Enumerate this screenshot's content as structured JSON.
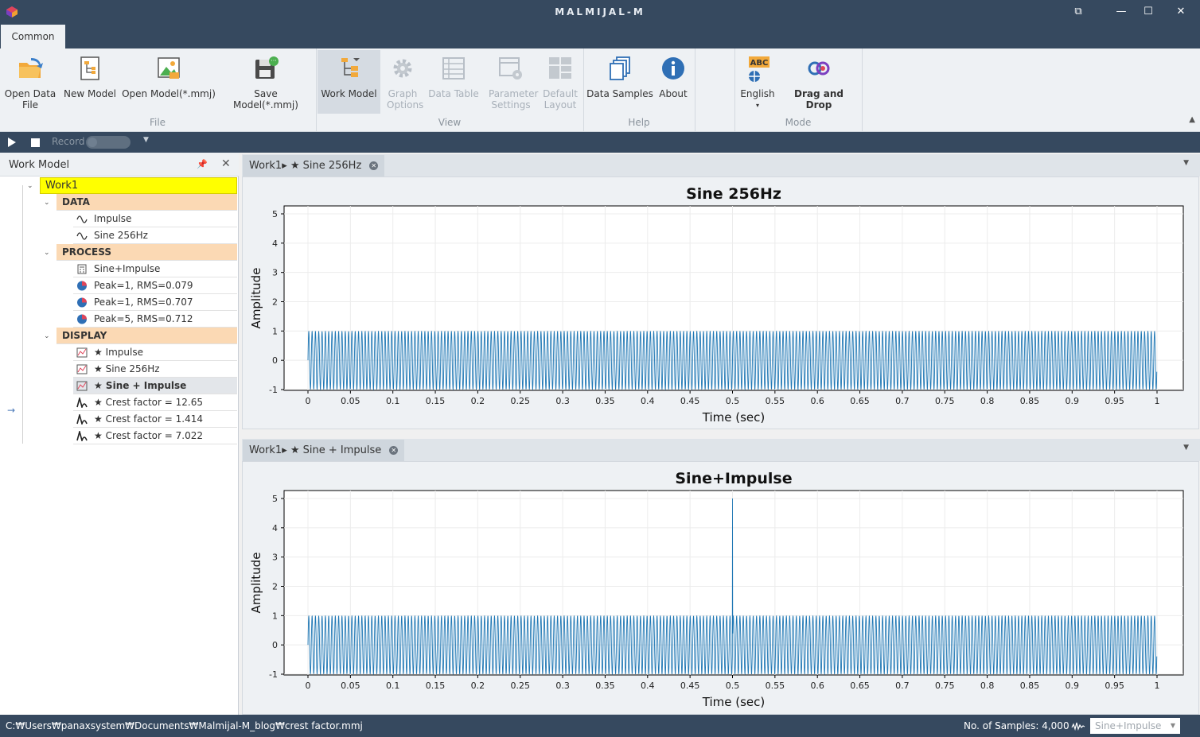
{
  "window": {
    "title": "MALMIJAL-M",
    "controls": {
      "restore": "⧉",
      "minimize": "—",
      "maximize": "☐",
      "close": "✕"
    }
  },
  "ribbon": {
    "tab": "Common",
    "buttons": {
      "open_data_file": "Open Data File",
      "new_model": "New Model",
      "open_model": "Open Model(*.mmj)",
      "save_model": "Save Model(*.mmj)",
      "work_model": "Work Model",
      "graph_options": "Graph Options",
      "data_table": "Data Table",
      "parameter_settings": "Parameter Settings",
      "default_layout": "Default Layout",
      "data_samples": "Data Samples",
      "about": "About",
      "english": "English",
      "drag_and_drop": "Drag and Drop"
    },
    "groups": {
      "file": "File",
      "view": "View",
      "help": "Help",
      "mode": "Mode"
    },
    "language_badge": "ABC"
  },
  "player": {
    "record_label": "Record"
  },
  "work_model_panel": {
    "title": "Work Model",
    "root": "Work1",
    "sections": {
      "data": "DATA",
      "process": "PROCESS",
      "display": "DISPLAY"
    },
    "data_items": [
      "Impulse",
      "Sine 256Hz"
    ],
    "process_items": [
      "Sine+Impulse",
      "Peak=1, RMS=0.079",
      "Peak=1, RMS=0.707",
      "Peak=5, RMS=0.712"
    ],
    "display_items": [
      "★ Impulse",
      "★ Sine 256Hz",
      "★ Sine + Impulse",
      "★ Crest factor = 12.65",
      "★ Crest factor = 1.414",
      "★ Crest factor = 7.022"
    ]
  },
  "doc1": {
    "tab_label": "Work1▸ ★ Sine 256Hz"
  },
  "doc2": {
    "tab_label": "Work1▸ ★ Sine + Impulse"
  },
  "chart_data": [
    {
      "type": "line",
      "title": "Sine 256Hz",
      "xlabel": "Time (sec)",
      "ylabel": "Amplitude",
      "xlim": [
        0,
        1
      ],
      "ylim": [
        -1,
        5
      ],
      "x_ticks": [
        "0",
        "0.05",
        "0.1",
        "0.15",
        "0.2",
        "0.25",
        "0.3",
        "0.35",
        "0.4",
        "0.45",
        "0.5",
        "0.55",
        "0.6",
        "0.65",
        "0.7",
        "0.75",
        "0.8",
        "0.85",
        "0.9",
        "0.95",
        "1"
      ],
      "y_ticks": [
        "-1",
        "0",
        "1",
        "2",
        "3",
        "4",
        "5"
      ],
      "grid": true,
      "color": "#1f77b4",
      "signal": {
        "kind": "sine",
        "frequency_hz": 256,
        "amplitude": 1,
        "samples": 4000,
        "impulse": null
      }
    },
    {
      "type": "line",
      "title": "Sine+Impulse",
      "xlabel": "Time (sec)",
      "ylabel": "Amplitude",
      "xlim": [
        0,
        1
      ],
      "ylim": [
        -1,
        5
      ],
      "x_ticks": [
        "0",
        "0.05",
        "0.1",
        "0.15",
        "0.2",
        "0.25",
        "0.3",
        "0.35",
        "0.4",
        "0.45",
        "0.5",
        "0.55",
        "0.6",
        "0.65",
        "0.7",
        "0.75",
        "0.8",
        "0.85",
        "0.9",
        "0.95",
        "1"
      ],
      "y_ticks": [
        "-1",
        "0",
        "1",
        "2",
        "3",
        "4",
        "5"
      ],
      "grid": true,
      "color": "#1f77b4",
      "signal": {
        "kind": "sine",
        "frequency_hz": 256,
        "amplitude": 1,
        "samples": 4000,
        "impulse": {
          "t": 0.5,
          "value": 5
        }
      }
    }
  ],
  "status": {
    "path": "C:₩Users₩panaxsystem₩Documents₩Malmijal-M_blog₩crest factor.mmj",
    "samples": "No. of Samples: 4,000",
    "selected_display": "Sine+Impulse"
  }
}
